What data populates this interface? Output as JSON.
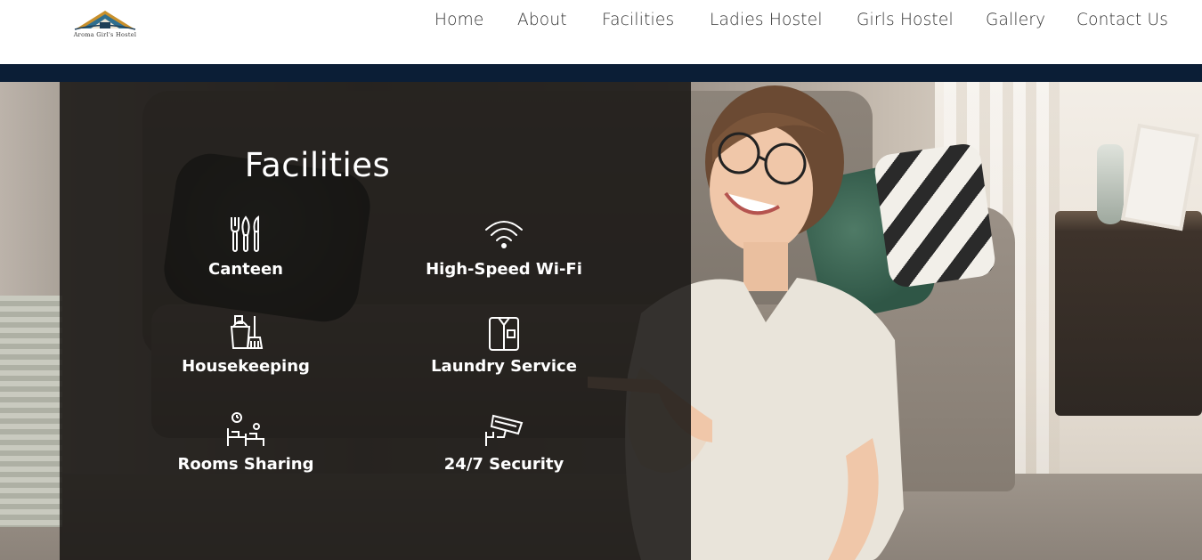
{
  "header": {
    "logo_text": "Aroma Girl's Hostel",
    "nav": [
      {
        "label": "Home"
      },
      {
        "label": "About"
      },
      {
        "label": "Facilities"
      },
      {
        "label": "Ladies Hostel"
      },
      {
        "label": "Girls Hostel"
      },
      {
        "label": "Gallery"
      },
      {
        "label": "Contact Us"
      }
    ]
  },
  "colors": {
    "accent_bar": "#0b1e36",
    "panel_overlay": "#161412"
  },
  "facilities": {
    "title": "Facilities",
    "items": [
      {
        "label": "Canteen",
        "icon": "cutlery-icon"
      },
      {
        "label": "High-Speed Wi-Fi",
        "icon": "wifi-icon"
      },
      {
        "label": "Housekeeping",
        "icon": "cleaning-bucket-icon"
      },
      {
        "label": "Laundry Service",
        "icon": "shirt-icon"
      },
      {
        "label": "Rooms Sharing",
        "icon": "beds-icon"
      },
      {
        "label": "24/7 Security",
        "icon": "cctv-camera-icon"
      }
    ]
  }
}
